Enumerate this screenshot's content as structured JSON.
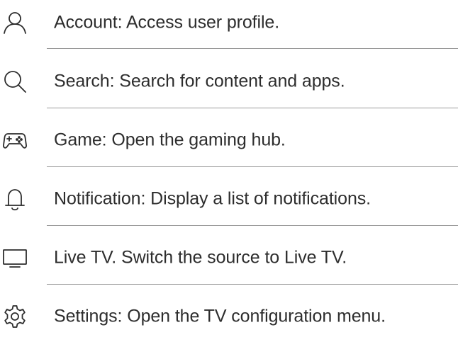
{
  "items": [
    {
      "icon": "account-icon",
      "label": "Account: Access user profile."
    },
    {
      "icon": "search-icon",
      "label": "Search: Search for content and apps."
    },
    {
      "icon": "gamepad-icon",
      "label": "Game: Open the gaming hub."
    },
    {
      "icon": "bell-icon",
      "label": "Notification: Display a list of notifications."
    },
    {
      "icon": "tv-icon",
      "label": "Live TV. Switch the source to Live TV."
    },
    {
      "icon": "gear-icon",
      "label": "Settings: Open the TV configuration menu."
    }
  ]
}
